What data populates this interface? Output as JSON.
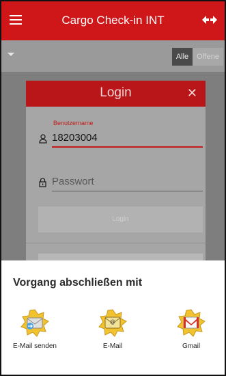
{
  "appbar": {
    "title": "Cargo Check-in INT",
    "menu_icon": "hamburger-menu-icon",
    "swap_icon": "swap-arrows-icon",
    "color": "#cf1619"
  },
  "filter": {
    "dropdown_icon": "caret-down-icon",
    "segments": [
      "Alle",
      "Offene"
    ],
    "selected": "Alle"
  },
  "login_dialog": {
    "title": "Login",
    "close_icon": "close-icon",
    "username_label": "Benutzername",
    "username_value": "18203004",
    "password_placeholder": "Passwort",
    "login_button": "Login",
    "accent_color": "#c41a1a"
  },
  "share_sheet": {
    "title": "Vorgang abschließen mit",
    "apps": [
      {
        "label": "E-Mail senden",
        "icon": "email-send-app-icon"
      },
      {
        "label": "E-Mail",
        "icon": "email-app-icon"
      },
      {
        "label": "Gmail",
        "icon": "gmail-app-icon"
      }
    ]
  }
}
